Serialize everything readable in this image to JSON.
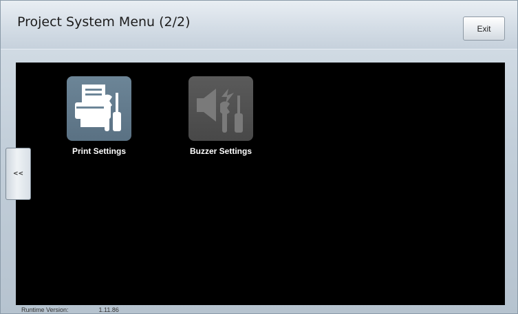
{
  "header": {
    "title": "Project System Menu (2/2)",
    "exit_label": "Exit"
  },
  "nav": {
    "back_label": "<<"
  },
  "tiles": [
    {
      "label": "Print Settings",
      "icon": "print-settings-icon",
      "enabled": true
    },
    {
      "label": "Buzzer Settings",
      "icon": "buzzer-settings-icon",
      "enabled": false
    }
  ],
  "status": {
    "runtime_label": "Runtime Version:",
    "runtime_value": "1.11.86"
  },
  "colors": {
    "content_bg": "#000000",
    "tile_enabled": "#617a8c",
    "tile_disabled": "#525252"
  }
}
